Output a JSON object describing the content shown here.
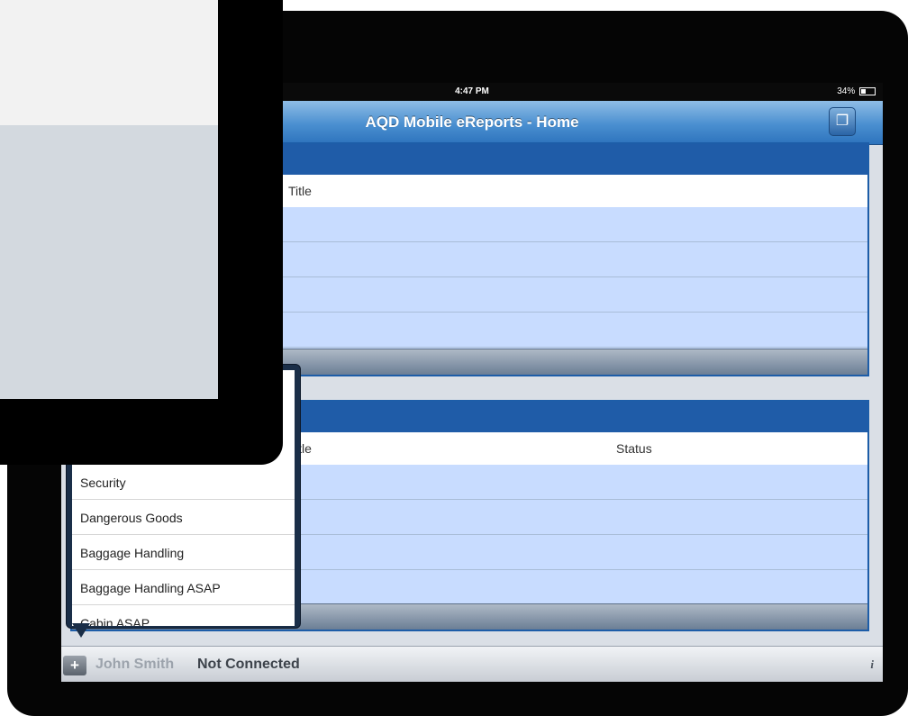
{
  "status_bar": {
    "time": "4:47 PM",
    "battery": "34%"
  },
  "nav_bar": {
    "title": "AQD Mobile eReports - Home",
    "right_icon": "copy-pages-icon"
  },
  "panel1": {
    "columns": [
      "Title"
    ],
    "rows": [
      {
        "title": ""
      },
      {
        "title": ""
      },
      {
        "title": ""
      },
      {
        "title": ""
      }
    ]
  },
  "panel2": {
    "columns": [
      "Title",
      "Status"
    ],
    "rows": [
      {
        "title": "",
        "status": ""
      },
      {
        "title": "",
        "status": ""
      },
      {
        "title": "",
        "status": ""
      },
      {
        "title": "",
        "status": ""
      }
    ]
  },
  "popover": {
    "items": [
      "Security",
      "Dangerous Goods",
      "Baggage Handling",
      "Baggage Handling ASAP",
      "Cabin ASAP"
    ]
  },
  "toolbar": {
    "add_icon": "plus-icon",
    "add_label": "+",
    "user_name": "John Smith",
    "connection_status": "Not Connected",
    "info_label": "i"
  },
  "colors": {
    "nav_blue": "#4a8fd0",
    "panel_header": "#1f5ca8",
    "row_fill": "#c8dcff",
    "popover_border": "#1a2e48"
  }
}
